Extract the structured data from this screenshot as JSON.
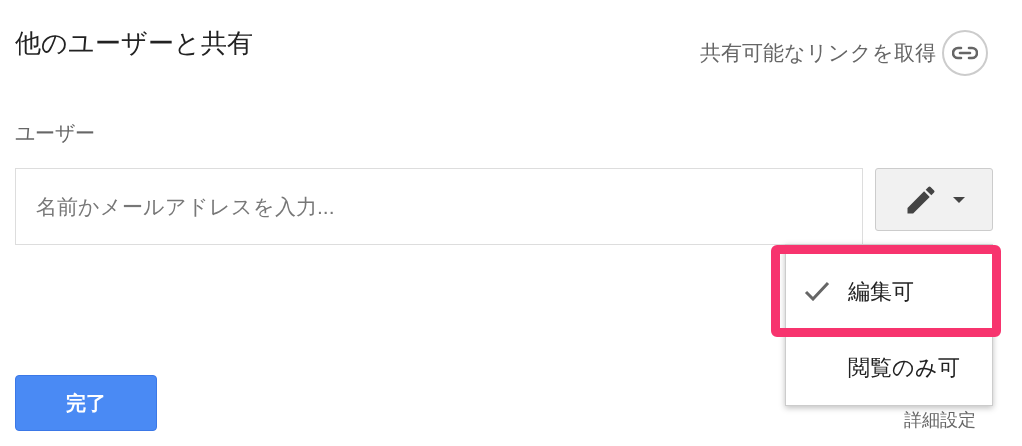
{
  "dialog": {
    "title": "他のユーザーと共有",
    "link_action": "共有可能なリンクを取得"
  },
  "people": {
    "label": "ユーザー",
    "placeholder": "名前かメールアドレスを入力..."
  },
  "permission_menu": {
    "items": [
      {
        "label": "編集可",
        "selected": true,
        "highlighted": true
      },
      {
        "label": "閲覧のみ可",
        "selected": false,
        "highlighted": false
      }
    ]
  },
  "done_button": "完了",
  "advanced_link": "詳細設定"
}
